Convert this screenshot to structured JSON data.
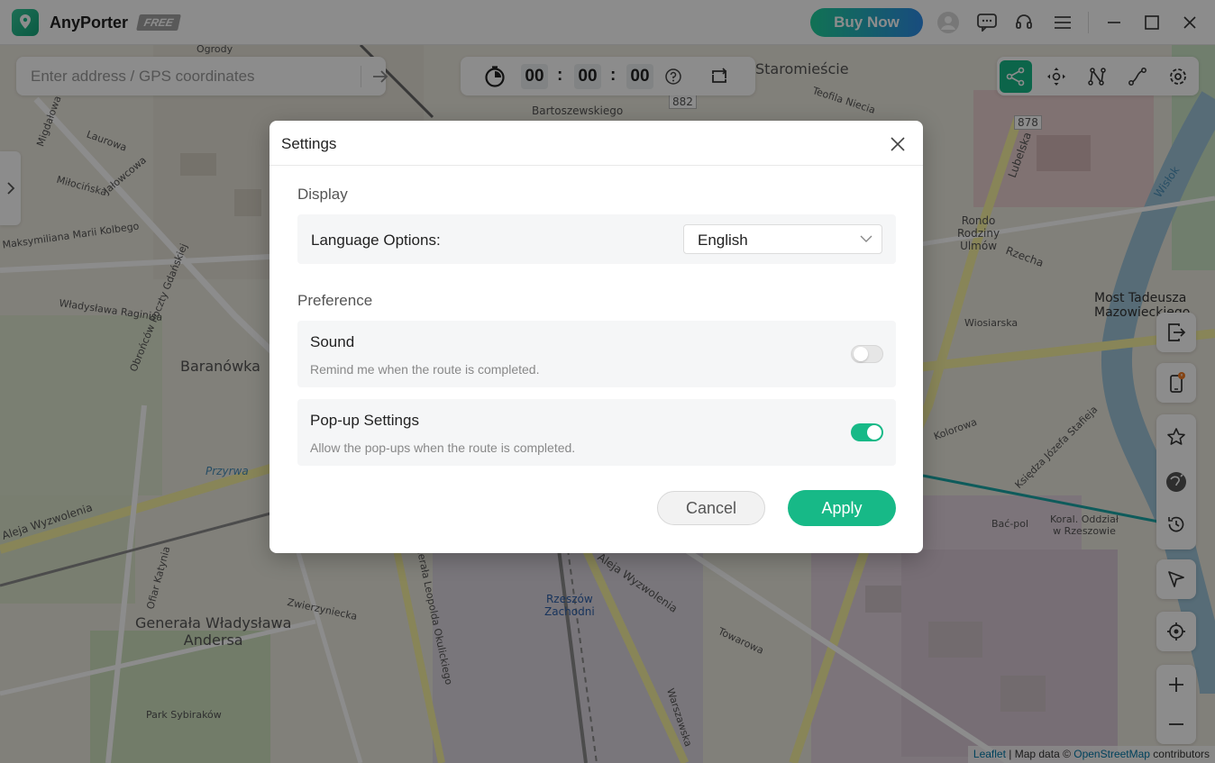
{
  "app": {
    "name": "AnyPorter",
    "badge": "FREE",
    "buy_now_label": "Buy Now",
    "accent_color": "#17b987"
  },
  "titlebar_icons": [
    "user-avatar-icon",
    "feedback-chat-icon",
    "support-headset-icon",
    "hamburger-menu-icon",
    "minimize-icon",
    "maximize-icon",
    "close-icon"
  ],
  "search": {
    "placeholder": "Enter address / GPS coordinates",
    "value": ""
  },
  "timer": {
    "hours": "00",
    "minutes": "00",
    "seconds": "00",
    "sep": ":"
  },
  "mode_toolbar": {
    "items": [
      "multi-spot-icon",
      "joystick-icon",
      "multi-stop-icon",
      "two-spot-icon",
      "settings-icon"
    ],
    "active": "multi-spot-icon"
  },
  "map": {
    "labels": {
      "staromiescie": "Staromieście",
      "staromiescie_ogrody": "Staromieście\nOgrody",
      "teofila_niecia": "Teofila Niecia",
      "bartoszewskiego": "Bartoszewskiego",
      "road_882": "882",
      "road_878": "878",
      "lubelska": "Lubelska",
      "wislok": "Wisłok",
      "rondo": "Rondo\nRodziny\nUlmów",
      "rzecha": "Rzecha",
      "wiosiarska": "Wiosiarska",
      "most": "Most Tadeusza\nMazowieckiego",
      "baranowka": "Baranówka",
      "migdalowa": "Migdałowa",
      "laurowa": "Laurowa",
      "milocinska": "Miłocińska",
      "ogrody": "Ogrody",
      "jalowcowa": "Jałowcowa",
      "kolbego": "Maksymiliana Marii Kolbego",
      "raginisa": "Władysława Raginisa",
      "obroncow": "Obrońców Poczty Gdańskiej",
      "przyrwa": "Przyrwa",
      "aleja_wyzwolenia": "Aleja Wyzwolenia",
      "generala_andersa": "Generała Władysława\nAndersa",
      "rzeszow_zachodni": "Rzeszów\nZachodni",
      "leopolda": "Generała Leopolda Okulickiego",
      "aleja_wyzwolenia_2": "Aleja Wyzwolenia",
      "koral": "Koral. Oddział\nw Rzeszowie",
      "bac_pol": "Bać-pol",
      "warszawska": "Warszawska",
      "park_sybirakow": "Park Sybiraków",
      "ofiar_katynia": "Ofiar Katynia",
      "zwierzyniecka": "Zwierzyniecka",
      "towarowa": "Towarowa",
      "kolorowa": "Kolorowa",
      "stafieja": "Księdza Józefa Stafieja"
    },
    "attribution": {
      "leaflet": "Leaflet",
      "mid": " | Map data © ",
      "osm": "OpenStreetMap",
      "tail": " contributors"
    }
  },
  "side_controls": [
    "exit-icon",
    "device-phone-icon",
    "favorite-star-icon",
    "jump-teleport-icon",
    "history-icon",
    "cursor-arrow-icon",
    "locate-target-icon",
    "zoom-in-icon",
    "zoom-out-icon"
  ],
  "dialog": {
    "title": "Settings",
    "display_section": "Display",
    "language_label": "Language Options:",
    "language_value": "English",
    "preference_section": "Preference",
    "sound_title": "Sound",
    "sound_desc": "Remind me when the route is completed.",
    "sound_enabled": false,
    "popup_title": "Pop-up Settings",
    "popup_desc": "Allow the pop-ups when the route is completed.",
    "popup_enabled": true,
    "cancel_label": "Cancel",
    "apply_label": "Apply"
  }
}
